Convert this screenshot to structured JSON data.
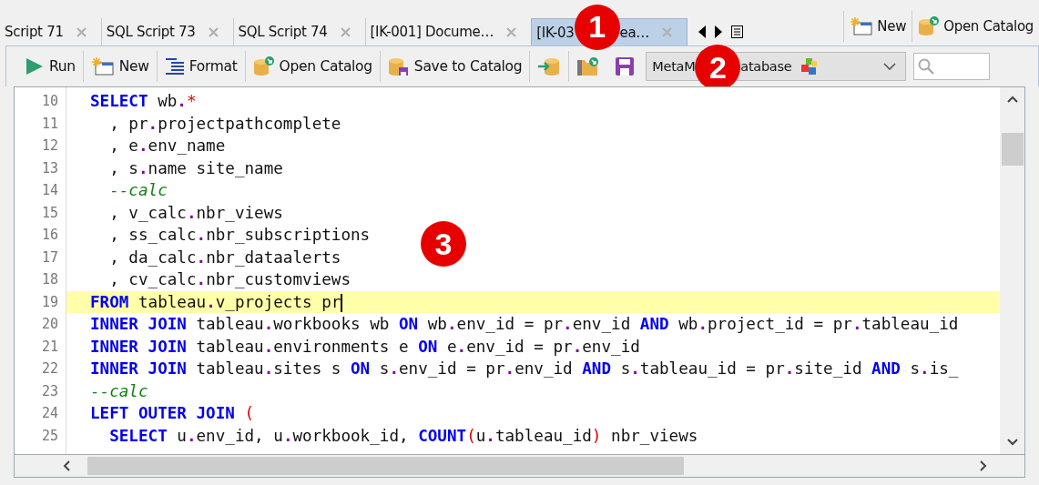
{
  "tabs": [
    {
      "label": "Script 71",
      "selected": false
    },
    {
      "label": "SQL Script 73",
      "selected": false
    },
    {
      "label": "SQL Script 74",
      "selected": false
    },
    {
      "label": "[IK-001] Docume…",
      "selected": false
    },
    {
      "label": "[IK-03",
      "label_end": "ea…",
      "selected": true
    }
  ],
  "tab_actions": [
    {
      "label": "New"
    },
    {
      "label": "Open Catalog"
    }
  ],
  "toolbar": [
    {
      "kind": "button",
      "label": "Run"
    },
    {
      "kind": "button",
      "label": "New"
    },
    {
      "kind": "button",
      "label": "Format"
    },
    {
      "kind": "button",
      "label": "Open Catalog"
    },
    {
      "kind": "button",
      "label": "Save to Catalog"
    },
    {
      "kind": "icon"
    },
    {
      "kind": "icon"
    },
    {
      "kind": "icon"
    }
  ],
  "database_select": {
    "value_start": "MetaM",
    "value_end": "atabase"
  },
  "editor": {
    "lines": [
      {
        "number": "10",
        "current": false,
        "tokens": [
          {
            "kind": "kw",
            "text": "SELECT"
          },
          {
            "kind": "text",
            "text": " wb"
          },
          {
            "kind": "dot",
            "text": "."
          },
          {
            "kind": "op",
            "text": "*"
          }
        ]
      },
      {
        "number": "11",
        "current": false,
        "tokens": [
          {
            "kind": "text",
            "text": "  , pr"
          },
          {
            "kind": "dot",
            "text": "."
          },
          {
            "kind": "text",
            "text": "projectpathcomplete"
          }
        ]
      },
      {
        "number": "12",
        "current": false,
        "tokens": [
          {
            "kind": "text",
            "text": "  , e"
          },
          {
            "kind": "dot",
            "text": "."
          },
          {
            "kind": "text",
            "text": "env_name"
          }
        ]
      },
      {
        "number": "13",
        "current": false,
        "tokens": [
          {
            "kind": "text",
            "text": "  , s"
          },
          {
            "kind": "dot",
            "text": "."
          },
          {
            "kind": "text",
            "text": "name site_name"
          }
        ]
      },
      {
        "number": "14",
        "current": false,
        "tokens": [
          {
            "kind": "comment",
            "text": "  --calc"
          }
        ]
      },
      {
        "number": "15",
        "current": false,
        "tokens": [
          {
            "kind": "text",
            "text": "  , v_calc"
          },
          {
            "kind": "dot",
            "text": "."
          },
          {
            "kind": "text",
            "text": "nbr_views"
          }
        ]
      },
      {
        "number": "16",
        "current": false,
        "tokens": [
          {
            "kind": "text",
            "text": "  , ss_calc"
          },
          {
            "kind": "dot",
            "text": "."
          },
          {
            "kind": "text",
            "text": "nbr_subscriptions"
          }
        ]
      },
      {
        "number": "17",
        "current": false,
        "tokens": [
          {
            "kind": "text",
            "text": "  , da_calc"
          },
          {
            "kind": "dot",
            "text": "."
          },
          {
            "kind": "text",
            "text": "nbr_dataalerts"
          }
        ]
      },
      {
        "number": "18",
        "current": false,
        "tokens": [
          {
            "kind": "text",
            "text": "  , cv_calc"
          },
          {
            "kind": "dot",
            "text": "."
          },
          {
            "kind": "text",
            "text": "nbr_customviews"
          }
        ]
      },
      {
        "number": "19",
        "current": true,
        "tokens": [
          {
            "kind": "kw",
            "text": "FROM"
          },
          {
            "kind": "text",
            "text": " tableau"
          },
          {
            "kind": "dot",
            "text": "."
          },
          {
            "kind": "text",
            "text": "v_projects pr"
          }
        ]
      },
      {
        "number": "20",
        "current": false,
        "tokens": [
          {
            "kind": "kw",
            "text": "INNER JOIN"
          },
          {
            "kind": "text",
            "text": " tableau"
          },
          {
            "kind": "dot",
            "text": "."
          },
          {
            "kind": "text",
            "text": "workbooks wb "
          },
          {
            "kind": "kw",
            "text": "ON"
          },
          {
            "kind": "text",
            "text": " wb"
          },
          {
            "kind": "dot",
            "text": "."
          },
          {
            "kind": "text",
            "text": "env_id = pr"
          },
          {
            "kind": "dot",
            "text": "."
          },
          {
            "kind": "text",
            "text": "env_id "
          },
          {
            "kind": "kw",
            "text": "AND"
          },
          {
            "kind": "text",
            "text": " wb"
          },
          {
            "kind": "dot",
            "text": "."
          },
          {
            "kind": "text",
            "text": "project_id = pr"
          },
          {
            "kind": "dot",
            "text": "."
          },
          {
            "kind": "text",
            "text": "tableau_id"
          }
        ]
      },
      {
        "number": "21",
        "current": false,
        "tokens": [
          {
            "kind": "kw",
            "text": "INNER JOIN"
          },
          {
            "kind": "text",
            "text": " tableau"
          },
          {
            "kind": "dot",
            "text": "."
          },
          {
            "kind": "text",
            "text": "environments e "
          },
          {
            "kind": "kw",
            "text": "ON"
          },
          {
            "kind": "text",
            "text": " e"
          },
          {
            "kind": "dot",
            "text": "."
          },
          {
            "kind": "text",
            "text": "env_id = pr"
          },
          {
            "kind": "dot",
            "text": "."
          },
          {
            "kind": "text",
            "text": "env_id"
          }
        ]
      },
      {
        "number": "22",
        "current": false,
        "tokens": [
          {
            "kind": "kw",
            "text": "INNER JOIN"
          },
          {
            "kind": "text",
            "text": " tableau"
          },
          {
            "kind": "dot",
            "text": "."
          },
          {
            "kind": "text",
            "text": "sites s "
          },
          {
            "kind": "kw",
            "text": "ON"
          },
          {
            "kind": "text",
            "text": " s"
          },
          {
            "kind": "dot",
            "text": "."
          },
          {
            "kind": "text",
            "text": "env_id = pr"
          },
          {
            "kind": "dot",
            "text": "."
          },
          {
            "kind": "text",
            "text": "env_id "
          },
          {
            "kind": "kw",
            "text": "AND"
          },
          {
            "kind": "text",
            "text": " s"
          },
          {
            "kind": "dot",
            "text": "."
          },
          {
            "kind": "text",
            "text": "tableau_id = pr"
          },
          {
            "kind": "dot",
            "text": "."
          },
          {
            "kind": "text",
            "text": "site_id "
          },
          {
            "kind": "kw",
            "text": "AND"
          },
          {
            "kind": "text",
            "text": " s"
          },
          {
            "kind": "dot",
            "text": "."
          },
          {
            "kind": "text",
            "text": "is_"
          }
        ]
      },
      {
        "number": "23",
        "current": false,
        "tokens": [
          {
            "kind": "comment",
            "text": "--calc"
          }
        ]
      },
      {
        "number": "24",
        "current": false,
        "tokens": [
          {
            "kind": "kw",
            "text": "LEFT OUTER JOIN"
          },
          {
            "kind": "op",
            "text": " ("
          }
        ]
      },
      {
        "number": "25",
        "current": false,
        "tokens": [
          {
            "kind": "kw",
            "text": "  SELECT"
          },
          {
            "kind": "text",
            "text": " u"
          },
          {
            "kind": "dot",
            "text": "."
          },
          {
            "kind": "text",
            "text": "env_id, u"
          },
          {
            "kind": "dot",
            "text": "."
          },
          {
            "kind": "text",
            "text": "workbook_id, "
          },
          {
            "kind": "kw",
            "text": "COUNT"
          },
          {
            "kind": "op",
            "text": "("
          },
          {
            "kind": "text",
            "text": "u"
          },
          {
            "kind": "dot",
            "text": "."
          },
          {
            "kind": "text",
            "text": "tableau_id"
          },
          {
            "kind": "op",
            "text": ")"
          },
          {
            "kind": "text",
            "text": " nbr_views"
          }
        ]
      }
    ]
  },
  "callouts": [
    {
      "label": "1"
    },
    {
      "label": "2"
    },
    {
      "label": "3"
    }
  ]
}
